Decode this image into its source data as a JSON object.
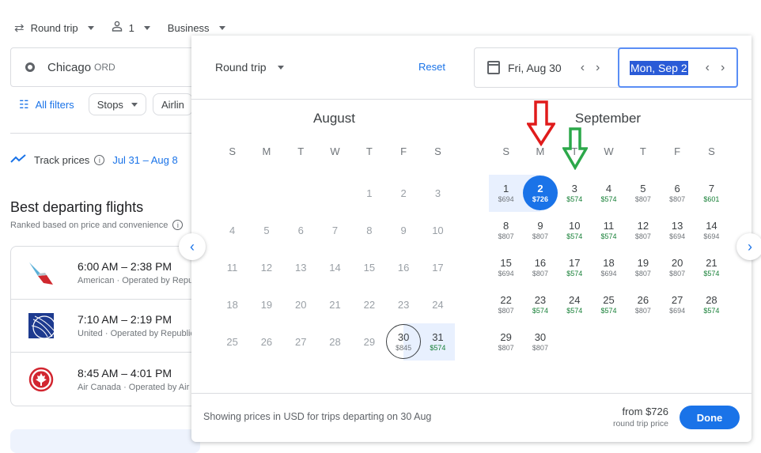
{
  "topbar": {
    "trip_type": "Round trip",
    "passengers": "1",
    "cabin_class": "Business"
  },
  "origin": {
    "city": "Chicago",
    "code": "ORD"
  },
  "filters": {
    "all_filters": "All filters",
    "stops": "Stops",
    "airlines": "Airlin"
  },
  "track": {
    "label": "Track prices",
    "dates": "Jul 31 – Aug 8"
  },
  "results": {
    "title": "Best departing flights",
    "subtitle": "Ranked based on price and convenience",
    "flights": [
      {
        "time": "6:00 AM – 2:38 PM",
        "airline": "American · Operated by Repu",
        "logo": "american-airlines"
      },
      {
        "time": "7:10 AM – 2:19 PM",
        "airline": "United · Operated by Republic",
        "logo": "united-airlines"
      },
      {
        "time": "8:45 AM – 4:01 PM",
        "airline": "Air Canada · Operated by Air",
        "logo": "air-canada"
      }
    ]
  },
  "picker": {
    "trip_type": "Round trip",
    "reset": "Reset",
    "depart": "Fri, Aug 30",
    "return": "Mon, Sep 2",
    "weekdays": [
      "S",
      "M",
      "T",
      "W",
      "T",
      "F",
      "S"
    ],
    "august": {
      "name": "August",
      "days": [
        {
          "d": "",
          "p": ""
        },
        {
          "d": "",
          "p": ""
        },
        {
          "d": "",
          "p": ""
        },
        {
          "d": "",
          "p": ""
        },
        {
          "d": "1",
          "p": ""
        },
        {
          "d": "2",
          "p": ""
        },
        {
          "d": "3",
          "p": ""
        },
        {
          "d": "4",
          "p": ""
        },
        {
          "d": "5",
          "p": ""
        },
        {
          "d": "6",
          "p": ""
        },
        {
          "d": "7",
          "p": ""
        },
        {
          "d": "8",
          "p": ""
        },
        {
          "d": "9",
          "p": ""
        },
        {
          "d": "10",
          "p": ""
        },
        {
          "d": "11",
          "p": ""
        },
        {
          "d": "12",
          "p": ""
        },
        {
          "d": "13",
          "p": ""
        },
        {
          "d": "14",
          "p": ""
        },
        {
          "d": "15",
          "p": ""
        },
        {
          "d": "16",
          "p": ""
        },
        {
          "d": "17",
          "p": ""
        },
        {
          "d": "18",
          "p": ""
        },
        {
          "d": "19",
          "p": ""
        },
        {
          "d": "20",
          "p": ""
        },
        {
          "d": "21",
          "p": ""
        },
        {
          "d": "22",
          "p": ""
        },
        {
          "d": "23",
          "p": ""
        },
        {
          "d": "24",
          "p": ""
        },
        {
          "d": "25",
          "p": ""
        },
        {
          "d": "26",
          "p": ""
        },
        {
          "d": "27",
          "p": ""
        },
        {
          "d": "28",
          "p": ""
        },
        {
          "d": "29",
          "p": ""
        },
        {
          "d": "30",
          "p": "$845",
          "state": "start"
        },
        {
          "d": "31",
          "p": "$574",
          "low": true,
          "state": "range"
        }
      ]
    },
    "september": {
      "name": "September",
      "days": [
        {
          "d": "1",
          "p": "$694",
          "state": "range"
        },
        {
          "d": "2",
          "p": "$726",
          "state": "end"
        },
        {
          "d": "3",
          "p": "$574",
          "low": true
        },
        {
          "d": "4",
          "p": "$574",
          "low": true
        },
        {
          "d": "5",
          "p": "$807"
        },
        {
          "d": "6",
          "p": "$807"
        },
        {
          "d": "7",
          "p": "$601",
          "low": true
        },
        {
          "d": "8",
          "p": "$807"
        },
        {
          "d": "9",
          "p": "$807"
        },
        {
          "d": "10",
          "p": "$574",
          "low": true
        },
        {
          "d": "11",
          "p": "$574",
          "low": true
        },
        {
          "d": "12",
          "p": "$807"
        },
        {
          "d": "13",
          "p": "$694"
        },
        {
          "d": "14",
          "p": "$694"
        },
        {
          "d": "15",
          "p": "$694"
        },
        {
          "d": "16",
          "p": "$807"
        },
        {
          "d": "17",
          "p": "$574",
          "low": true
        },
        {
          "d": "18",
          "p": "$694"
        },
        {
          "d": "19",
          "p": "$807"
        },
        {
          "d": "20",
          "p": "$807"
        },
        {
          "d": "21",
          "p": "$574",
          "low": true
        },
        {
          "d": "22",
          "p": "$807"
        },
        {
          "d": "23",
          "p": "$574",
          "low": true
        },
        {
          "d": "24",
          "p": "$574",
          "low": true
        },
        {
          "d": "25",
          "p": "$574",
          "low": true
        },
        {
          "d": "26",
          "p": "$807"
        },
        {
          "d": "27",
          "p": "$694"
        },
        {
          "d": "28",
          "p": "$574",
          "low": true
        },
        {
          "d": "29",
          "p": "$807"
        },
        {
          "d": "30",
          "p": "$807"
        }
      ]
    },
    "footer": {
      "showing": "Showing prices in USD for trips departing on 30 Aug",
      "from": "from $726",
      "from_sub": "round trip price",
      "done": "Done"
    }
  },
  "colors": {
    "accent": "#1a73e8",
    "low_price": "#188038",
    "range": "#e8f0fe",
    "annotation_red": "#e01b1b",
    "annotation_green": "#2ca84a"
  }
}
